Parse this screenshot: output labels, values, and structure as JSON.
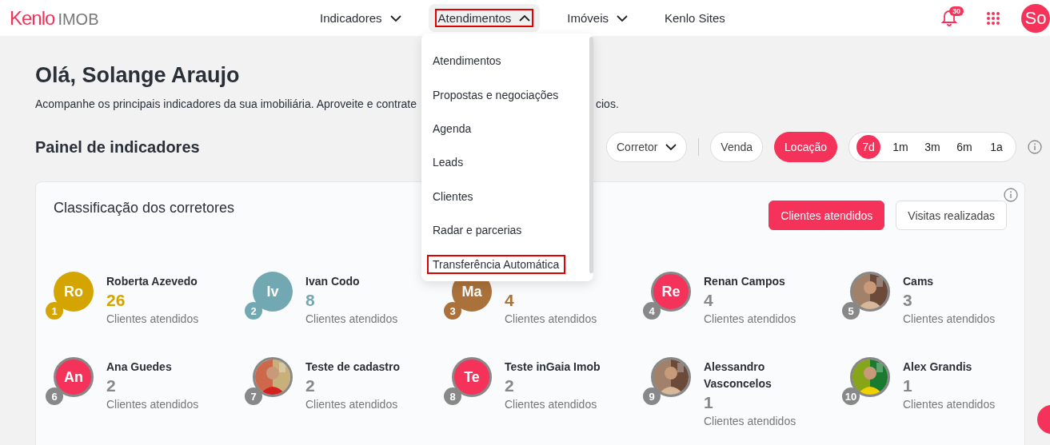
{
  "header": {
    "logo_brand": "Kenlo",
    "logo_product": "IMOB",
    "nav": [
      {
        "label": "Indicadores",
        "dropdown": true,
        "expanded": false,
        "highlighted": false
      },
      {
        "label": "Atendimentos",
        "dropdown": true,
        "expanded": true,
        "highlighted": true
      },
      {
        "label": "Imóveis",
        "dropdown": true,
        "expanded": false,
        "highlighted": false
      },
      {
        "label": "Kenlo Sites",
        "dropdown": false,
        "expanded": false,
        "highlighted": false
      }
    ],
    "notification_count": "30",
    "avatar": "So"
  },
  "menu": {
    "items": [
      {
        "label": "Atendimentos",
        "highlighted": false
      },
      {
        "label": "Propostas e negociações",
        "highlighted": false
      },
      {
        "label": "Agenda",
        "highlighted": false
      },
      {
        "label": "Leads",
        "highlighted": false
      },
      {
        "label": "Clientes",
        "highlighted": false
      },
      {
        "label": "Radar e parcerias",
        "highlighted": false
      },
      {
        "label": "Transferência Automática",
        "highlighted": true
      }
    ]
  },
  "greeting": "Olá, Solange Araujo",
  "subtitle_start": "Acompanhe os principais indicadores da sua imobiliária. Aproveite e contrate",
  "subtitle_end": "cios.",
  "panel": {
    "title": "Painel de indicadores",
    "broker_filter": "Corretor",
    "deal_types": [
      {
        "label": "Venda",
        "selected": false
      },
      {
        "label": "Locação",
        "selected": true
      }
    ],
    "periods": [
      {
        "label": "7d",
        "selected": true
      },
      {
        "label": "1m",
        "selected": false
      },
      {
        "label": "3m",
        "selected": false
      },
      {
        "label": "6m",
        "selected": false
      },
      {
        "label": "1a",
        "selected": false
      }
    ]
  },
  "ranking": {
    "title": "Classificação dos corretores",
    "metrics": [
      {
        "label": "Clientes atendidos",
        "selected": true
      },
      {
        "label": "Visitas realizadas",
        "selected": false
      }
    ],
    "brokers": [
      {
        "rank": "1",
        "kind": "podium",
        "initials": "Ro",
        "name": "Roberta Azevedo",
        "count": "26",
        "label": "Clientes atendidos",
        "color": "#d4a500"
      },
      {
        "rank": "2",
        "kind": "podium",
        "initials": "Iv",
        "name": "Ivan Codo",
        "count": "8",
        "label": "Clientes atendidos",
        "color": "#72a8b1"
      },
      {
        "rank": "3",
        "kind": "podium",
        "initials": "Ma",
        "count": "4",
        "label": "Clientes atendidos",
        "color": "#aa713b"
      },
      {
        "rank": "4",
        "kind": "initials",
        "initials": "Re",
        "name": "Renan Campos",
        "count": "4",
        "label": "Clientes atendidos",
        "color": "#888888"
      },
      {
        "rank": "5",
        "name": "Cams",
        "count": "3",
        "label": "Clientes atendidos",
        "color": "#888888"
      },
      {
        "rank": "6",
        "kind": "initials",
        "initials": "An",
        "name": "Ana Guedes",
        "count": "2",
        "label": "Clientes atendidos",
        "color": "#888888"
      },
      {
        "rank": "7",
        "name": "Teste de cadastro",
        "count": "2",
        "label": "Clientes atendidos",
        "color": "#888888"
      },
      {
        "rank": "8",
        "kind": "initials",
        "initials": "Te",
        "name": "Teste inGaia Imob",
        "count": "2",
        "label": "Clientes atendidos",
        "color": "#888888"
      },
      {
        "rank": "9",
        "name": "Alessandro Vasconcelos",
        "count": "1",
        "label": "Clientes atendidos",
        "color": "#888888"
      },
      {
        "rank": "10",
        "name": "Alex Grandis",
        "count": "1",
        "label": "Clientes atendidos",
        "color": "#888888"
      }
    ]
  }
}
